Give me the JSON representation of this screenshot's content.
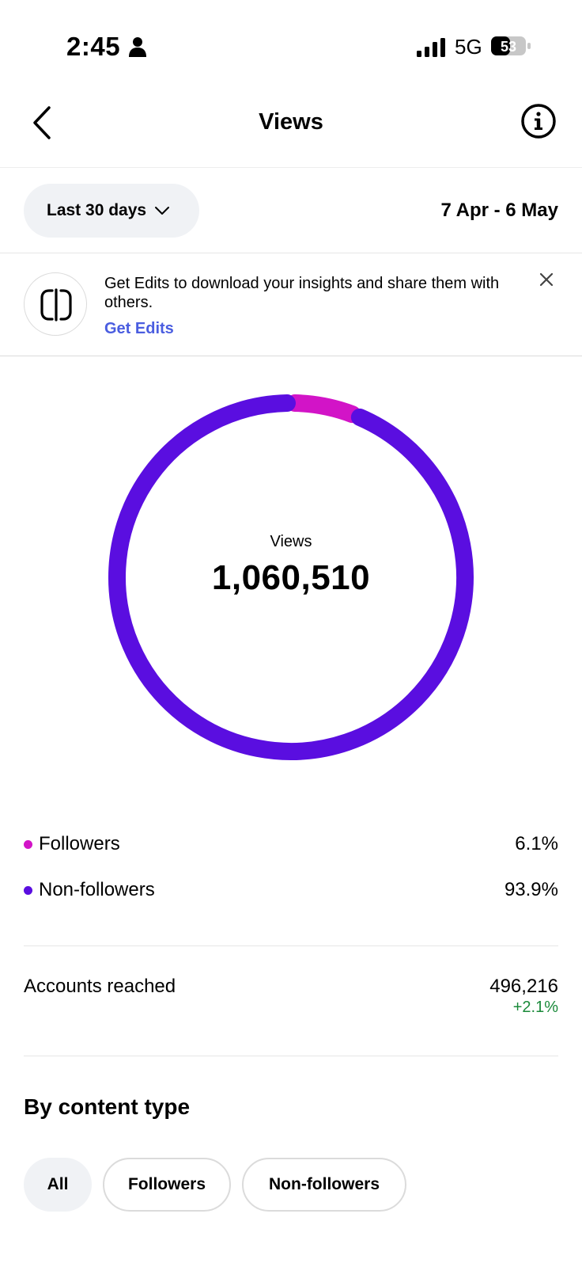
{
  "status_bar": {
    "time": "2:45",
    "network": "5G",
    "battery": "53"
  },
  "nav": {
    "title": "Views"
  },
  "range": {
    "selected": "Last 30 days",
    "dates": "7 Apr - 6 May"
  },
  "promo": {
    "text": "Get Edits to download your insights and share them with others.",
    "link": "Get Edits"
  },
  "summary": {
    "label": "Views",
    "total": "1,060,510"
  },
  "chart_data": {
    "type": "pie",
    "categories": [
      "Followers",
      "Non-followers"
    ],
    "values": [
      6.1,
      93.9
    ],
    "colors": [
      "#d214c7",
      "#5a0ee0"
    ]
  },
  "legend": [
    {
      "label": "Followers",
      "value": "6.1%",
      "color": "#d214c7"
    },
    {
      "label": "Non-followers",
      "value": "93.9%",
      "color": "#5a0ee0"
    }
  ],
  "accounts_reached": {
    "label": "Accounts reached",
    "value": "496,216",
    "change": "+2.1%"
  },
  "content_type": {
    "title": "By content type",
    "chips": [
      "All",
      "Followers",
      "Non-followers"
    ]
  }
}
